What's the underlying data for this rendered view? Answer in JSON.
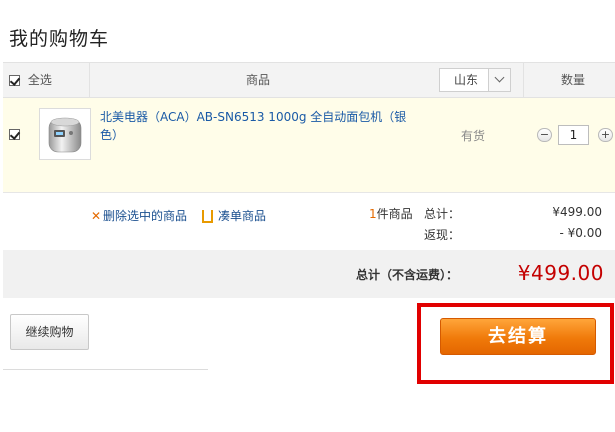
{
  "page": {
    "title": "我的购物车"
  },
  "header": {
    "select_all": "全选",
    "product": "商品",
    "region_value": "山东",
    "quantity": "数量"
  },
  "item": {
    "title": "北美电器（ACA）AB-SN6513 1000g 全自动面包机（银色）",
    "stock": "有货",
    "quantity": "1",
    "minus": "−",
    "plus": "+"
  },
  "actions": {
    "delete_selected": "删除选中的商品",
    "add_on": "凑单商品"
  },
  "summary": {
    "count": "1",
    "count_suffix": "件商品",
    "total_label": "总计：",
    "total_value": "¥499.00",
    "rebate_label": "返现：",
    "rebate_value": "- ¥0.00"
  },
  "total_bar": {
    "label": "总计（不含运费）：",
    "amount": "¥499.00"
  },
  "buttons": {
    "continue": "继续购物",
    "checkout": "去结算"
  },
  "colors": {
    "accent_orange": "#f07a0a",
    "price_red": "#c40000",
    "link_blue": "#1a5aa6",
    "highlight_red": "#e10000"
  }
}
